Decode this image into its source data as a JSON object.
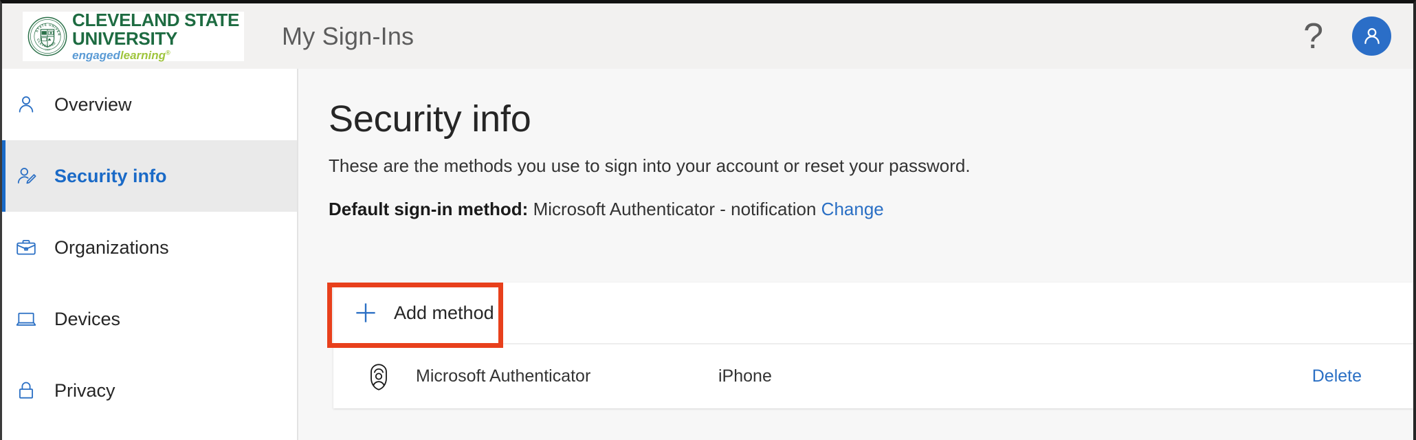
{
  "header": {
    "logo": {
      "seal_alt": "cleveland-state-university-seal",
      "line1": "CLEVELAND STATE",
      "line2": "UNIVERSITY",
      "tagline_part1": "engaged",
      "tagline_part2": "learning",
      "tagline_tm": "®"
    },
    "app_title": "My Sign-Ins",
    "help_glyph": "?",
    "avatar_icon": "person-icon"
  },
  "sidebar": {
    "items": [
      {
        "id": "overview",
        "label": "Overview",
        "icon": "person-icon",
        "active": false
      },
      {
        "id": "security-info",
        "label": "Security info",
        "icon": "person-edit-icon",
        "active": true
      },
      {
        "id": "organizations",
        "label": "Organizations",
        "icon": "briefcase-icon",
        "active": false
      },
      {
        "id": "devices",
        "label": "Devices",
        "icon": "laptop-icon",
        "active": false
      },
      {
        "id": "privacy",
        "label": "Privacy",
        "icon": "padlock-icon",
        "active": false
      }
    ]
  },
  "main": {
    "page_title": "Security info",
    "subtitle": "These are the methods you use to sign into your account or reset your password.",
    "default_method": {
      "label": "Default sign-in method:",
      "value": "Microsoft Authenticator - notification",
      "change_link": "Change"
    },
    "add_method": {
      "label": "Add method",
      "icon": "plus-icon"
    },
    "methods": [
      {
        "icon": "microsoft-authenticator-icon",
        "name": "Microsoft Authenticator",
        "detail": "iPhone",
        "actions": [
          "Delete"
        ]
      }
    ]
  },
  "annotation": {
    "target": "add-method-button",
    "color": "#e8401c"
  },
  "colors": {
    "accent_blue": "#1a6ac7",
    "link_blue": "#2a6fc4",
    "brand_green": "#1d6b41",
    "tagline_blue": "#5b9bd5",
    "tagline_green": "#9fc53d",
    "header_bg": "#f2f1f0",
    "content_bg": "#f7f7f7",
    "annotation_red": "#e8401c"
  }
}
